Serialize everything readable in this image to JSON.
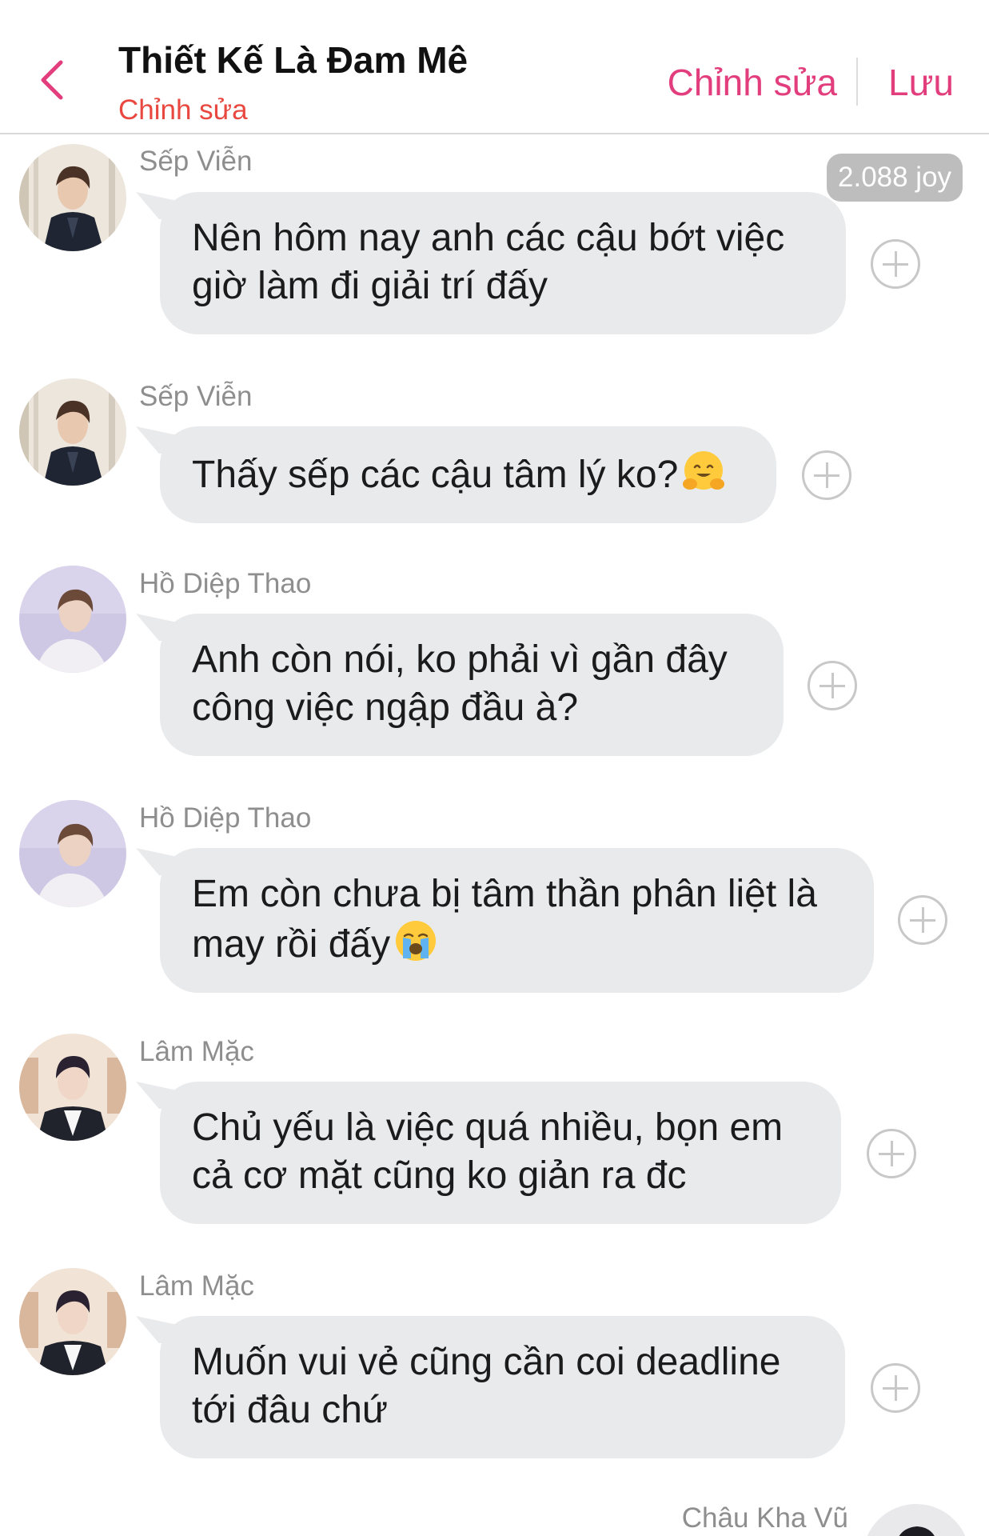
{
  "header": {
    "title": "Thiết Kế Là Đam Mê",
    "subtitle": "Chỉnh sửa",
    "edit_label": "Chỉnh sửa",
    "save_label": "Lưu",
    "back_icon": "chevron-left-icon",
    "accent_color": "#e23d7c"
  },
  "badge": {
    "label": "2.088 joy"
  },
  "messages": [
    {
      "sender": "Sếp Viễn",
      "lines": [
        "Nên hôm nay anh các cậu bớt việc",
        "giờ làm đi giải trí đấy"
      ]
    },
    {
      "sender": "Sếp Viễn",
      "lines": [
        "Thấy sếp các cậu tâm lý ko?"
      ],
      "emoji": "hugging-face-emoji"
    },
    {
      "sender": "Hồ Diệp Thao",
      "lines": [
        "Anh còn nói, ko phải vì gần đây",
        "công việc ngập đầu à?"
      ]
    },
    {
      "sender": "Hồ Diệp Thao",
      "lines": [
        "Em còn chưa bị tâm thần phân liệt là",
        "may rồi đấy"
      ],
      "emoji": "loudly-crying-face-emoji"
    },
    {
      "sender": "Lâm Mặc",
      "lines": [
        "Chủ yếu là việc quá nhiều, bọn em",
        "cả cơ mặt cũng ko giản ra đc"
      ]
    },
    {
      "sender": "Lâm Mặc",
      "lines": [
        "Muốn vui vẻ cũng cần coi deadline",
        "tới đâu chứ"
      ]
    }
  ],
  "partial_message": {
    "sender": "Châu Kha Vũ"
  }
}
